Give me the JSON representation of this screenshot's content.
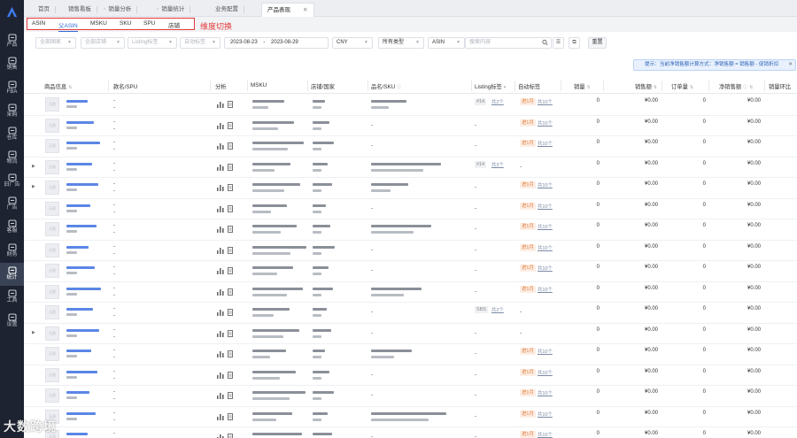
{
  "sidebar": {
    "items": [
      {
        "label": "产品",
        "icon": "box-icon"
      },
      {
        "label": "销售",
        "icon": "cart-icon"
      },
      {
        "label": "FBA",
        "icon": "warehouse-icon"
      },
      {
        "label": "采购",
        "icon": "purchase-icon"
      },
      {
        "label": "仓库",
        "icon": "storehouse-icon"
      },
      {
        "label": "物流",
        "icon": "truck-icon"
      },
      {
        "label": "旧广告",
        "icon": "megaphone-icon"
      },
      {
        "label": "广告",
        "icon": "ad-icon"
      },
      {
        "label": "客服",
        "icon": "mail-icon"
      },
      {
        "label": "财务",
        "icon": "finance-icon"
      },
      {
        "label": "统计",
        "icon": "chart-icon"
      },
      {
        "label": "工具",
        "icon": "tool-icon"
      },
      {
        "label": "设置",
        "icon": "settings-icon"
      }
    ],
    "active_index": 10
  },
  "top_tabs": [
    "首页",
    "销售看板",
    "销量分析",
    "销量统计",
    "业务配置",
    "产品表现"
  ],
  "dimension_tabs": [
    "ASIN",
    "父ASIN",
    "MSKU",
    "SKU",
    "SPU",
    "店铺"
  ],
  "dimension_active": 1,
  "annotation": "维度切换",
  "filters": {
    "country": "全部国家",
    "shop": "全部店铺",
    "listing_tag": "Listing标签",
    "auto_tag": "自动标签",
    "start_date": "2023-08-23",
    "end_date": "2023-08-29",
    "date_sep": "-",
    "currency": "CNY",
    "type": "所有类型",
    "search_field": "ASIN",
    "search_placeholder": "搜索内容",
    "reset": "重置"
  },
  "tip": "提示：当前净销售额计算方式：净销售额 = 销售额 - 促销折扣",
  "columns": [
    "商品信息",
    "款名/SPU",
    "分析",
    "MSKU",
    "店铺/国家",
    "品名/SKU",
    "Listing标签",
    "自动标签",
    "销量",
    "销售额",
    "订单量",
    "净销售额",
    "销量环比"
  ],
  "rows": [
    {
      "expand": false,
      "listing_tag": "#14",
      "listing_link": "共2个",
      "auto_tag": "进1月",
      "auto_link": "共10个",
      "qty": "0",
      "sales": "¥0.00",
      "orders": "0",
      "net": "¥0.00"
    },
    {
      "expand": false,
      "listing_tag": "",
      "listing_link": "",
      "auto_tag": "进1月",
      "auto_link": "共10个",
      "qty": "0",
      "sales": "¥0.00",
      "orders": "0",
      "net": "¥0.00"
    },
    {
      "expand": false,
      "listing_tag": "",
      "listing_link": "",
      "auto_tag": "进1月",
      "auto_link": "共10个",
      "qty": "0",
      "sales": "¥0.00",
      "orders": "0",
      "net": "¥0.00"
    },
    {
      "expand": true,
      "listing_tag": "#14",
      "listing_link": "共3个",
      "auto_tag": "",
      "auto_link": "",
      "qty": "0",
      "sales": "¥0.00",
      "orders": "0",
      "net": "¥0.00"
    },
    {
      "expand": true,
      "listing_tag": "",
      "listing_link": "",
      "auto_tag": "进1月",
      "auto_link": "共10个",
      "qty": "0",
      "sales": "¥0.00",
      "orders": "0",
      "net": "¥0.00"
    },
    {
      "expand": false,
      "listing_tag": "",
      "listing_link": "",
      "auto_tag": "进1月",
      "auto_link": "共10个",
      "qty": "0",
      "sales": "¥0.00",
      "orders": "0",
      "net": "¥0.00"
    },
    {
      "expand": false,
      "listing_tag": "",
      "listing_link": "",
      "auto_tag": "进1月",
      "auto_link": "共10个",
      "qty": "0",
      "sales": "¥0.00",
      "orders": "0",
      "net": "¥0.00"
    },
    {
      "expand": false,
      "listing_tag": "",
      "listing_link": "",
      "auto_tag": "进1月",
      "auto_link": "共10个",
      "qty": "0",
      "sales": "¥0.00",
      "orders": "0",
      "net": "¥0.00"
    },
    {
      "expand": false,
      "listing_tag": "",
      "listing_link": "",
      "auto_tag": "进1月",
      "auto_link": "共10个",
      "qty": "0",
      "sales": "¥0.00",
      "orders": "0",
      "net": "¥0.00"
    },
    {
      "expand": false,
      "listing_tag": "",
      "listing_link": "",
      "auto_tag": "进1月",
      "auto_link": "共10个",
      "qty": "0",
      "sales": "¥0.00",
      "orders": "0",
      "net": "¥0.00"
    },
    {
      "expand": false,
      "listing_tag": "SBS",
      "listing_link": "共2个",
      "auto_tag": "",
      "auto_link": "",
      "qty": "0",
      "sales": "¥0.00",
      "orders": "0",
      "net": "¥0.00"
    },
    {
      "expand": true,
      "listing_tag": "",
      "listing_link": "",
      "auto_tag": "",
      "auto_link": "",
      "qty": "0",
      "sales": "¥0.00",
      "orders": "0",
      "net": "¥0.00"
    },
    {
      "expand": false,
      "listing_tag": "",
      "listing_link": "",
      "auto_tag": "进1月",
      "auto_link": "共10个",
      "qty": "0",
      "sales": "¥0.00",
      "orders": "0",
      "net": "¥0.00"
    },
    {
      "expand": false,
      "listing_tag": "",
      "listing_link": "",
      "auto_tag": "进1月",
      "auto_link": "共10个",
      "qty": "0",
      "sales": "¥0.00",
      "orders": "0",
      "net": "¥0.00"
    },
    {
      "expand": false,
      "listing_tag": "",
      "listing_link": "",
      "auto_tag": "进1月",
      "auto_link": "共10个",
      "qty": "0",
      "sales": "¥0.00",
      "orders": "0",
      "net": "¥0.00"
    },
    {
      "expand": false,
      "listing_tag": "",
      "listing_link": "",
      "auto_tag": "进1月",
      "auto_link": "共10个",
      "qty": "0",
      "sales": "¥0.00",
      "orders": "0",
      "net": "¥0.00"
    },
    {
      "expand": false,
      "listing_tag": "",
      "listing_link": "",
      "auto_tag": "进1月",
      "auto_link": "共10个",
      "qty": "0",
      "sales": "¥0.00",
      "orders": "0",
      "net": "¥0.00"
    }
  ],
  "placeholder_dash": "-",
  "thumb_label": "无图",
  "watermark": "大数跨境",
  "colors": {
    "sidebar": "#1d2331",
    "accent": "#2f6bd8",
    "annotation": "#e23b3b",
    "tag_orange": "#e07a3a"
  }
}
